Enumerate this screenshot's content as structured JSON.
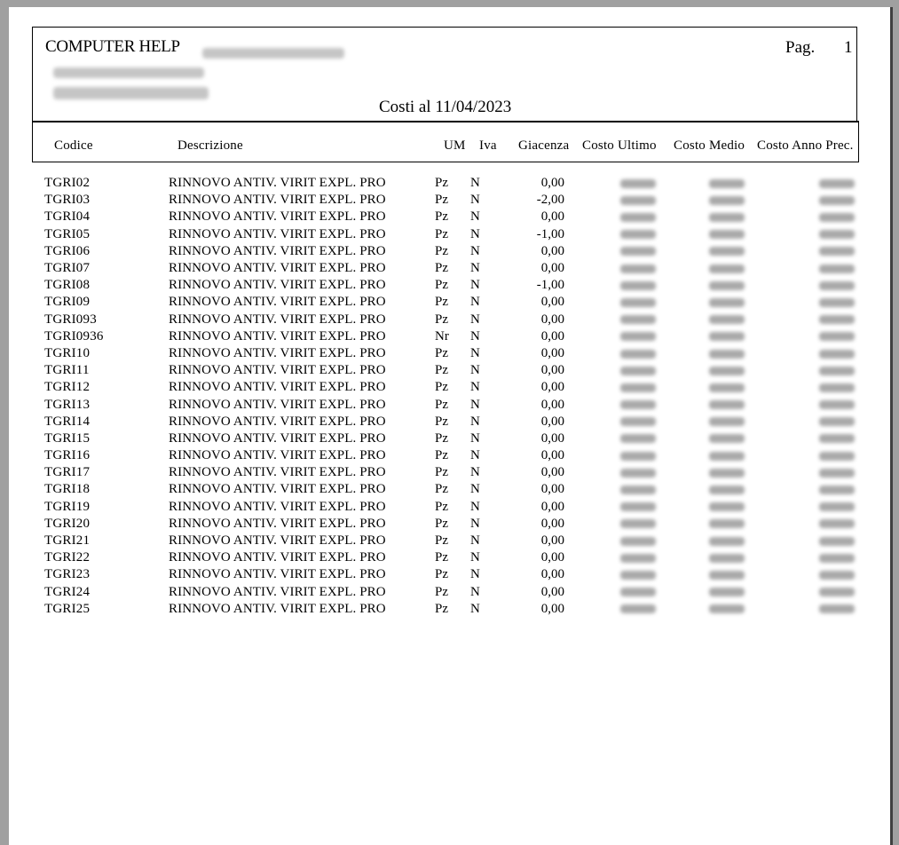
{
  "report": {
    "company": "COMPUTER HELP",
    "page_label": "Pag.",
    "page_number": "1",
    "title": "Costi al 11/04/2023"
  },
  "columns": {
    "codice": "Codice",
    "descrizione": "Descrizione",
    "um": "UM",
    "iva": "Iva",
    "giacenza": "Giacenza",
    "costo_ultimo": "Costo Ultimo",
    "costo_medio": "Costo Medio",
    "costo_anno_prec": "Costo Anno Prec."
  },
  "rows": [
    {
      "codice": "TGRI02",
      "descrizione": "RINNOVO ANTIV. VIRIT EXPL. PRO",
      "um": "Pz",
      "iva": "N",
      "giacenza": "0,00"
    },
    {
      "codice": "TGRI03",
      "descrizione": "RINNOVO ANTIV. VIRIT EXPL. PRO",
      "um": "Pz",
      "iva": "N",
      "giacenza": "-2,00"
    },
    {
      "codice": "TGRI04",
      "descrizione": "RINNOVO ANTIV. VIRIT EXPL. PRO",
      "um": "Pz",
      "iva": "N",
      "giacenza": "0,00"
    },
    {
      "codice": "TGRI05",
      "descrizione": "RINNOVO ANTIV. VIRIT EXPL. PRO",
      "um": "Pz",
      "iva": "N",
      "giacenza": "-1,00"
    },
    {
      "codice": "TGRI06",
      "descrizione": "RINNOVO ANTIV. VIRIT EXPL. PRO",
      "um": "Pz",
      "iva": "N",
      "giacenza": "0,00"
    },
    {
      "codice": "TGRI07",
      "descrizione": "RINNOVO ANTIV. VIRIT EXPL. PRO",
      "um": "Pz",
      "iva": "N",
      "giacenza": "0,00"
    },
    {
      "codice": "TGRI08",
      "descrizione": "RINNOVO ANTIV. VIRIT EXPL. PRO",
      "um": "Pz",
      "iva": "N",
      "giacenza": "-1,00"
    },
    {
      "codice": "TGRI09",
      "descrizione": "RINNOVO ANTIV. VIRIT EXPL. PRO",
      "um": "Pz",
      "iva": "N",
      "giacenza": "0,00"
    },
    {
      "codice": "TGRI093",
      "descrizione": "RINNOVO ANTIV. VIRIT EXPL. PRO",
      "um": "Pz",
      "iva": "N",
      "giacenza": "0,00"
    },
    {
      "codice": "TGRI0936",
      "descrizione": "RINNOVO ANTIV. VIRIT EXPL. PRO",
      "um": "Nr",
      "iva": "N",
      "giacenza": "0,00"
    },
    {
      "codice": "TGRI10",
      "descrizione": "RINNOVO ANTIV. VIRIT EXPL. PRO",
      "um": "Pz",
      "iva": "N",
      "giacenza": "0,00"
    },
    {
      "codice": "TGRI11",
      "descrizione": "RINNOVO ANTIV. VIRIT EXPL. PRO",
      "um": "Pz",
      "iva": "N",
      "giacenza": "0,00"
    },
    {
      "codice": "TGRI12",
      "descrizione": "RINNOVO ANTIV. VIRIT EXPL. PRO",
      "um": "Pz",
      "iva": "N",
      "giacenza": "0,00"
    },
    {
      "codice": "TGRI13",
      "descrizione": "RINNOVO ANTIV. VIRIT EXPL. PRO",
      "um": "Pz",
      "iva": "N",
      "giacenza": "0,00"
    },
    {
      "codice": "TGRI14",
      "descrizione": "RINNOVO ANTIV. VIRIT EXPL. PRO",
      "um": "Pz",
      "iva": "N",
      "giacenza": "0,00"
    },
    {
      "codice": "TGRI15",
      "descrizione": "RINNOVO ANTIV. VIRIT EXPL. PRO",
      "um": "Pz",
      "iva": "N",
      "giacenza": "0,00"
    },
    {
      "codice": "TGRI16",
      "descrizione": "RINNOVO ANTIV. VIRIT EXPL. PRO",
      "um": "Pz",
      "iva": "N",
      "giacenza": "0,00"
    },
    {
      "codice": "TGRI17",
      "descrizione": "RINNOVO ANTIV. VIRIT EXPL. PRO",
      "um": "Pz",
      "iva": "N",
      "giacenza": "0,00"
    },
    {
      "codice": "TGRI18",
      "descrizione": "RINNOVO ANTIV. VIRIT EXPL. PRO",
      "um": "Pz",
      "iva": "N",
      "giacenza": "0,00"
    },
    {
      "codice": "TGRI19",
      "descrizione": "RINNOVO ANTIV. VIRIT EXPL. PRO",
      "um": "Pz",
      "iva": "N",
      "giacenza": "0,00"
    },
    {
      "codice": "TGRI20",
      "descrizione": "RINNOVO ANTIV. VIRIT EXPL. PRO",
      "um": "Pz",
      "iva": "N",
      "giacenza": "0,00"
    },
    {
      "codice": "TGRI21",
      "descrizione": "RINNOVO ANTIV. VIRIT EXPL. PRO",
      "um": "Pz",
      "iva": "N",
      "giacenza": "0,00"
    },
    {
      "codice": "TGRI22",
      "descrizione": "RINNOVO ANTIV. VIRIT EXPL. PRO",
      "um": "Pz",
      "iva": "N",
      "giacenza": "0,00"
    },
    {
      "codice": "TGRI23",
      "descrizione": "RINNOVO ANTIV. VIRIT EXPL. PRO",
      "um": "Pz",
      "iva": "N",
      "giacenza": "0,00"
    },
    {
      "codice": "TGRI24",
      "descrizione": "RINNOVO ANTIV. VIRIT EXPL. PRO",
      "um": "Pz",
      "iva": "N",
      "giacenza": "0,00"
    },
    {
      "codice": "TGRI25",
      "descrizione": "RINNOVO ANTIV. VIRIT EXPL. PRO",
      "um": "Pz",
      "iva": "N",
      "giacenza": "0,00"
    }
  ],
  "colors": {
    "background": "#a0a0a0",
    "paper": "#ffffff",
    "ink": "#000000"
  }
}
